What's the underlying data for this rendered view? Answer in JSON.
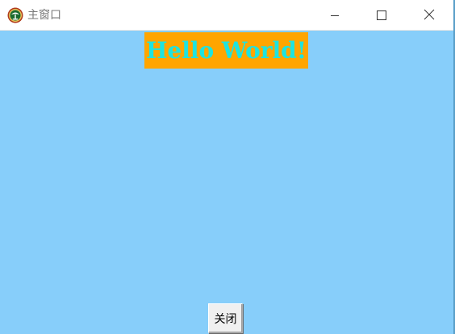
{
  "window": {
    "title": "主窗口",
    "app_icon": "emblem-icon",
    "controls": {
      "minimize": "minimize-icon",
      "maximize": "maximize-icon",
      "close": "close-icon"
    }
  },
  "main": {
    "heading": "Hello World!",
    "close_button_label": "关闭"
  },
  "colors": {
    "background": "#87cefa",
    "heading_background": "#ffa500",
    "heading_text": "#1ee3e0",
    "titlebar": "#ffffff"
  }
}
